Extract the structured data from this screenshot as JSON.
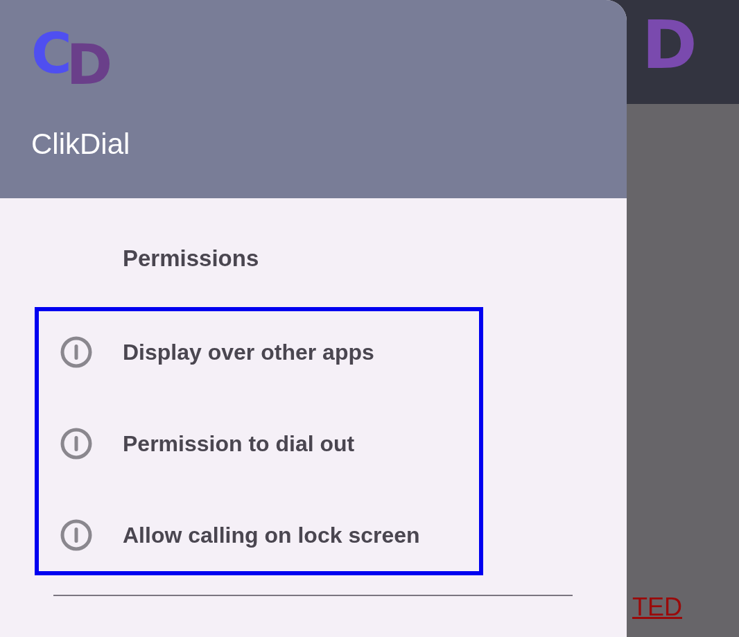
{
  "background": {
    "logo": "D",
    "link": "TED"
  },
  "drawer": {
    "logo": {
      "first": "C",
      "second": "D"
    },
    "app_name": "ClikDial",
    "section_title": "Permissions",
    "items": [
      {
        "label": "Display over other apps"
      },
      {
        "label": "Permission to dial out"
      },
      {
        "label": "Allow calling on lock screen"
      }
    ]
  }
}
